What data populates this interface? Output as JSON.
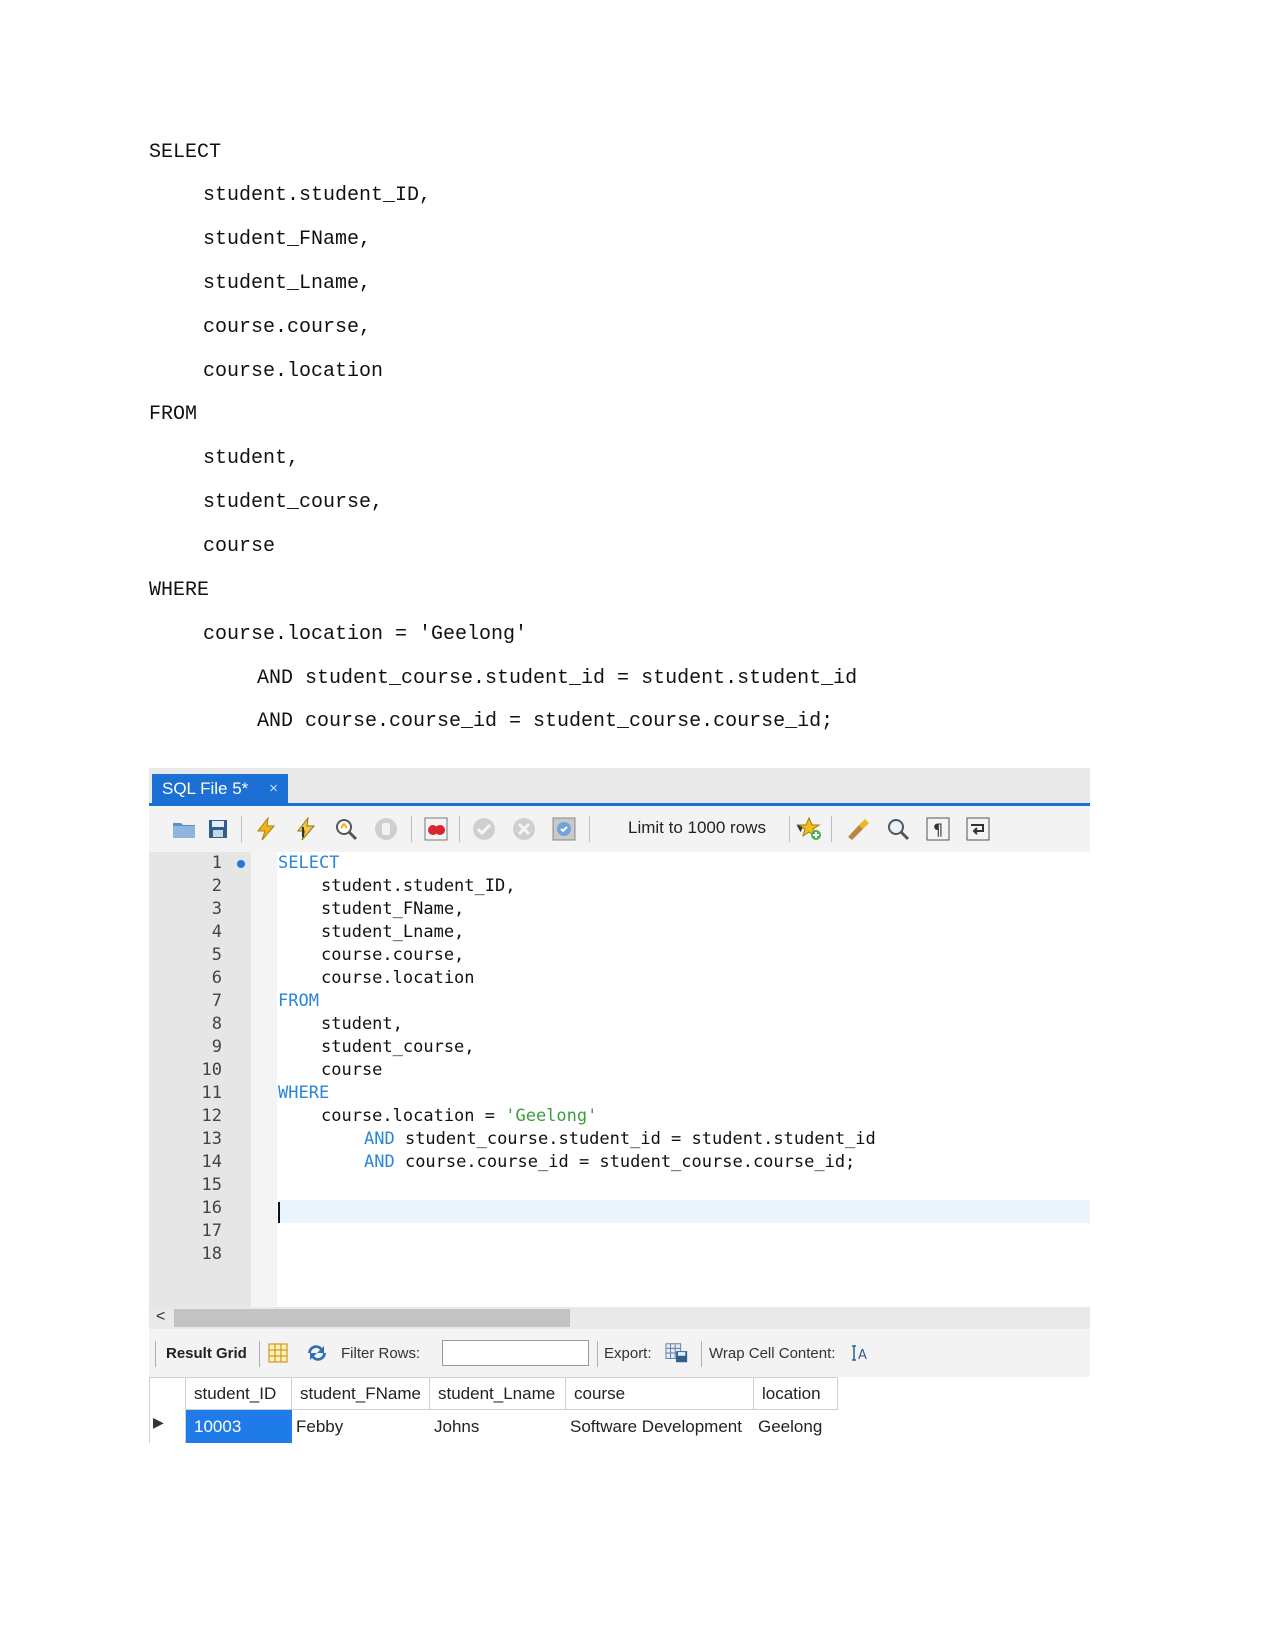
{
  "document": {
    "lines": [
      "SELECT",
      "student.student_ID,",
      "student_FName,",
      "student_Lname,",
      "course.course,",
      "course.location",
      "FROM",
      "student,",
      "student_course,",
      "course",
      "WHERE",
      "course.location = 'Geelong'",
      "AND student_course.student_id = student.student_id",
      "AND course.course_id = student_course.course_id;"
    ]
  },
  "workbench": {
    "tab_label": "SQL File 5*",
    "tab_close": "×",
    "toolbar": {
      "icons": [
        "open-folder-icon",
        "save-icon",
        "execute-icon",
        "execute-current-icon",
        "explain-icon",
        "stop-icon",
        "toggle-error-icon",
        "commit-icon",
        "rollback-icon",
        "autocommit-icon",
        "limit-dropdown",
        "beautify-icon",
        "snippet-icon",
        "find-icon",
        "invisible-chars-icon",
        "wrap-icon"
      ],
      "limit_label": "Limit to 1000 rows"
    },
    "editor": {
      "line_numbers": [
        "1",
        "2",
        "3",
        "4",
        "5",
        "6",
        "7",
        "8",
        "9",
        "10",
        "11",
        "12",
        "13",
        "14",
        "15",
        "16",
        "17",
        "18"
      ],
      "code": {
        "l1": "SELECT",
        "l2": "student.student_ID,",
        "l3": "student_FName,",
        "l4": "student_Lname,",
        "l5": "course.course,",
        "l6": "course.location",
        "l7": "FROM",
        "l8": "student,",
        "l9": "student_course,",
        "l10": "course",
        "l11": "WHERE",
        "l12_a": "course.location = ",
        "l12_b": "'Geelong'",
        "l13_kw": "AND",
        "l13_rest": " student_course.student_id = student.student_id",
        "l14_kw": "AND",
        "l14_rest": " course.course_id = student_course.course_id;"
      }
    },
    "result_bar": {
      "result_grid": "Result Grid",
      "filter_rows": "Filter Rows:",
      "filter_value": "",
      "export": "Export:",
      "wrap": "Wrap Cell Content:"
    },
    "grid": {
      "columns": [
        "student_ID",
        "student_FName",
        "student_Lname",
        "course",
        "location"
      ],
      "rows": [
        [
          "10003",
          "Febby",
          "Johns",
          "Software Development",
          "Geelong"
        ]
      ]
    }
  }
}
